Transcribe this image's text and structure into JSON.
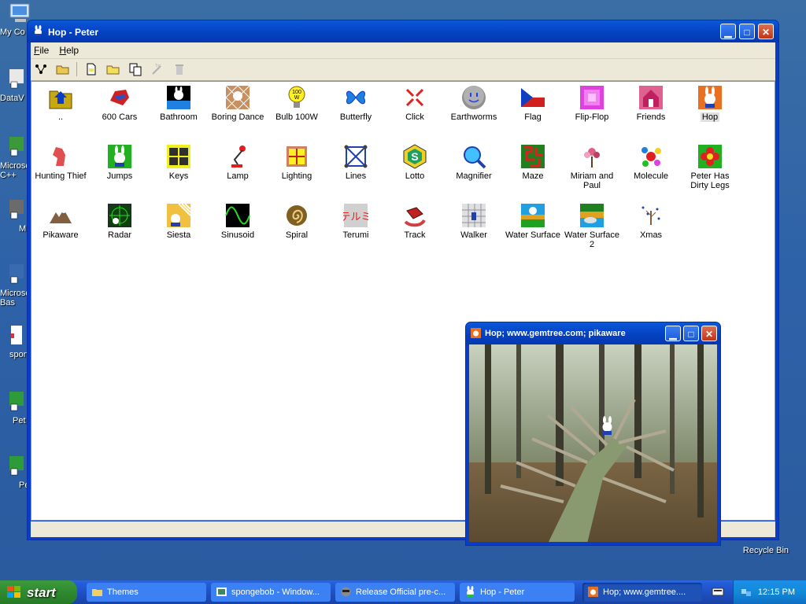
{
  "desktop": {
    "icons": [
      {
        "label": "My Co"
      },
      {
        "label": "DataV"
      },
      {
        "label": "Microso C++"
      },
      {
        "label": "M"
      },
      {
        "label": "Microso Bas"
      },
      {
        "label": "spon"
      },
      {
        "label": "Pet"
      },
      {
        "label": "Pe"
      }
    ],
    "recycle_bin": "Recycle Bin"
  },
  "main_window": {
    "title": "Hop - Peter",
    "menu": {
      "file": "File",
      "help": "Help"
    },
    "items": [
      {
        "label": "..",
        "icon": "folder-up-icon"
      },
      {
        "label": "600 Cars",
        "icon": "car-icon"
      },
      {
        "label": "Bathroom",
        "icon": "bathroom-icon"
      },
      {
        "label": "Boring Dance",
        "icon": "dance-icon"
      },
      {
        "label": "Bulb 100W",
        "icon": "bulb-icon",
        "badge": "100 W"
      },
      {
        "label": "Butterfly",
        "icon": "butterfly-icon"
      },
      {
        "label": "Click",
        "icon": "click-icon"
      },
      {
        "label": "Earthworms",
        "icon": "ball-face-icon"
      },
      {
        "label": "Flag",
        "icon": "flag-icon"
      },
      {
        "label": "Flip-Flop",
        "icon": "flip-flop-icon"
      },
      {
        "label": "Friends",
        "icon": "house-icon"
      },
      {
        "label": "Hop",
        "icon": "bunny-icon"
      },
      {
        "label": "Hunting Thief",
        "icon": "thief-icon"
      },
      {
        "label": "Jumps",
        "icon": "bunny-green-icon"
      },
      {
        "label": "Keys",
        "icon": "keys-icon"
      },
      {
        "label": "Lamp",
        "icon": "lamp-icon"
      },
      {
        "label": "Lighting",
        "icon": "window-icon"
      },
      {
        "label": "Lines",
        "icon": "lines-icon"
      },
      {
        "label": "Lotto",
        "icon": "lotto-icon"
      },
      {
        "label": "Magnifier",
        "icon": "magnifier-icon"
      },
      {
        "label": "Maze",
        "icon": "maze-icon"
      },
      {
        "label": "Miriam and Paul",
        "icon": "flowers-icon"
      },
      {
        "label": "Molecule",
        "icon": "molecule-icon"
      },
      {
        "label": "Peter Has Dirty Legs",
        "icon": "flower-icon"
      },
      {
        "label": "Pikaware",
        "icon": "pikaware-icon"
      },
      {
        "label": "Radar",
        "icon": "radar-icon"
      },
      {
        "label": "Siesta",
        "icon": "siesta-icon"
      },
      {
        "label": "Sinusoid",
        "icon": "sinusoid-icon"
      },
      {
        "label": "Spiral",
        "icon": "spiral-icon"
      },
      {
        "label": "Terumi",
        "icon": "terumi-icon",
        "badge": "テルミ"
      },
      {
        "label": "Track",
        "icon": "track-icon"
      },
      {
        "label": "Walker",
        "icon": "walker-icon"
      },
      {
        "label": "Water Surface",
        "icon": "water-icon"
      },
      {
        "label": "Water Surface 2",
        "icon": "water2-icon"
      },
      {
        "label": "Xmas",
        "icon": "xmas-icon"
      }
    ],
    "selected_item": "Hop"
  },
  "popup_window": {
    "title": "Hop;   www.gemtree.com;   pikaware"
  },
  "taskbar": {
    "start": "start",
    "tasks": [
      {
        "label": "Themes"
      },
      {
        "label": "spongebob - Window..."
      },
      {
        "label": "Release Official pre-c..."
      },
      {
        "label": "Hop - Peter"
      },
      {
        "label": "Hop;   www.gemtree...."
      }
    ],
    "clock": "12:15 PM"
  },
  "colors": {
    "title_blue": "#0543c4",
    "desktop_blue": "#2e62a8",
    "start_green": "#2f8a2f",
    "close_red": "#c03418"
  }
}
